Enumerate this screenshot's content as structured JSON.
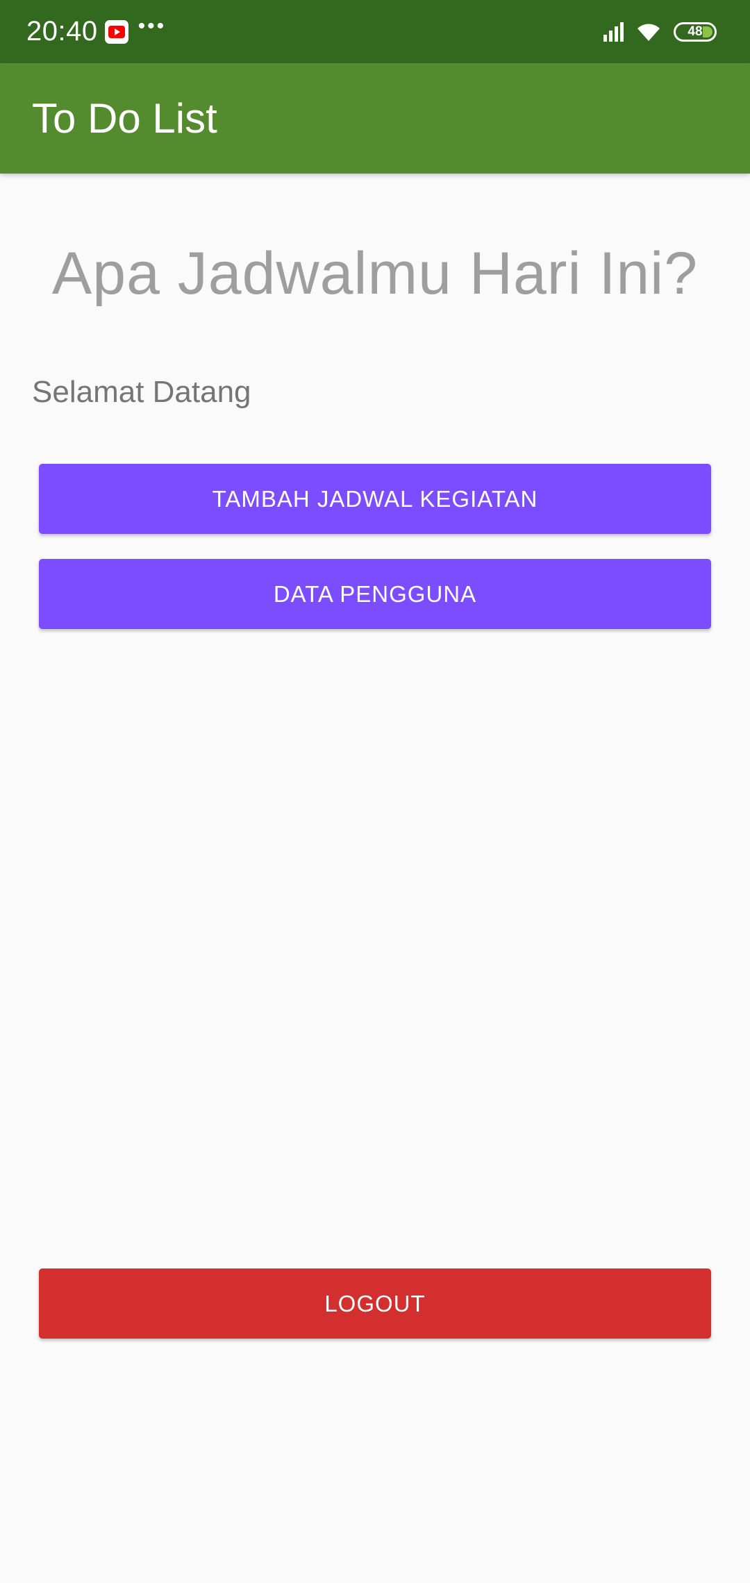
{
  "status_bar": {
    "time": "20:40",
    "notification_icons": [
      "youtube-icon",
      "more-icon"
    ],
    "more_glyph": "•••",
    "battery_level": "48",
    "system_icons": [
      "signal-icon",
      "wifi-icon",
      "battery-icon"
    ]
  },
  "app_bar": {
    "title": "To Do List"
  },
  "main": {
    "headline": "Apa Jadwalmu Hari Ini?",
    "welcome": "Selamat Datang",
    "add_schedule_label": "TAMBAH JADWAL KEGIATAN",
    "user_data_label": "DATA PENGGUNA",
    "logout_label": "LOGOUT"
  },
  "colors": {
    "status_bar": "#33691e",
    "app_bar": "#558b2f",
    "primary_button": "#7c4dff",
    "logout_button": "#d32f2f",
    "background": "#fafafa"
  }
}
